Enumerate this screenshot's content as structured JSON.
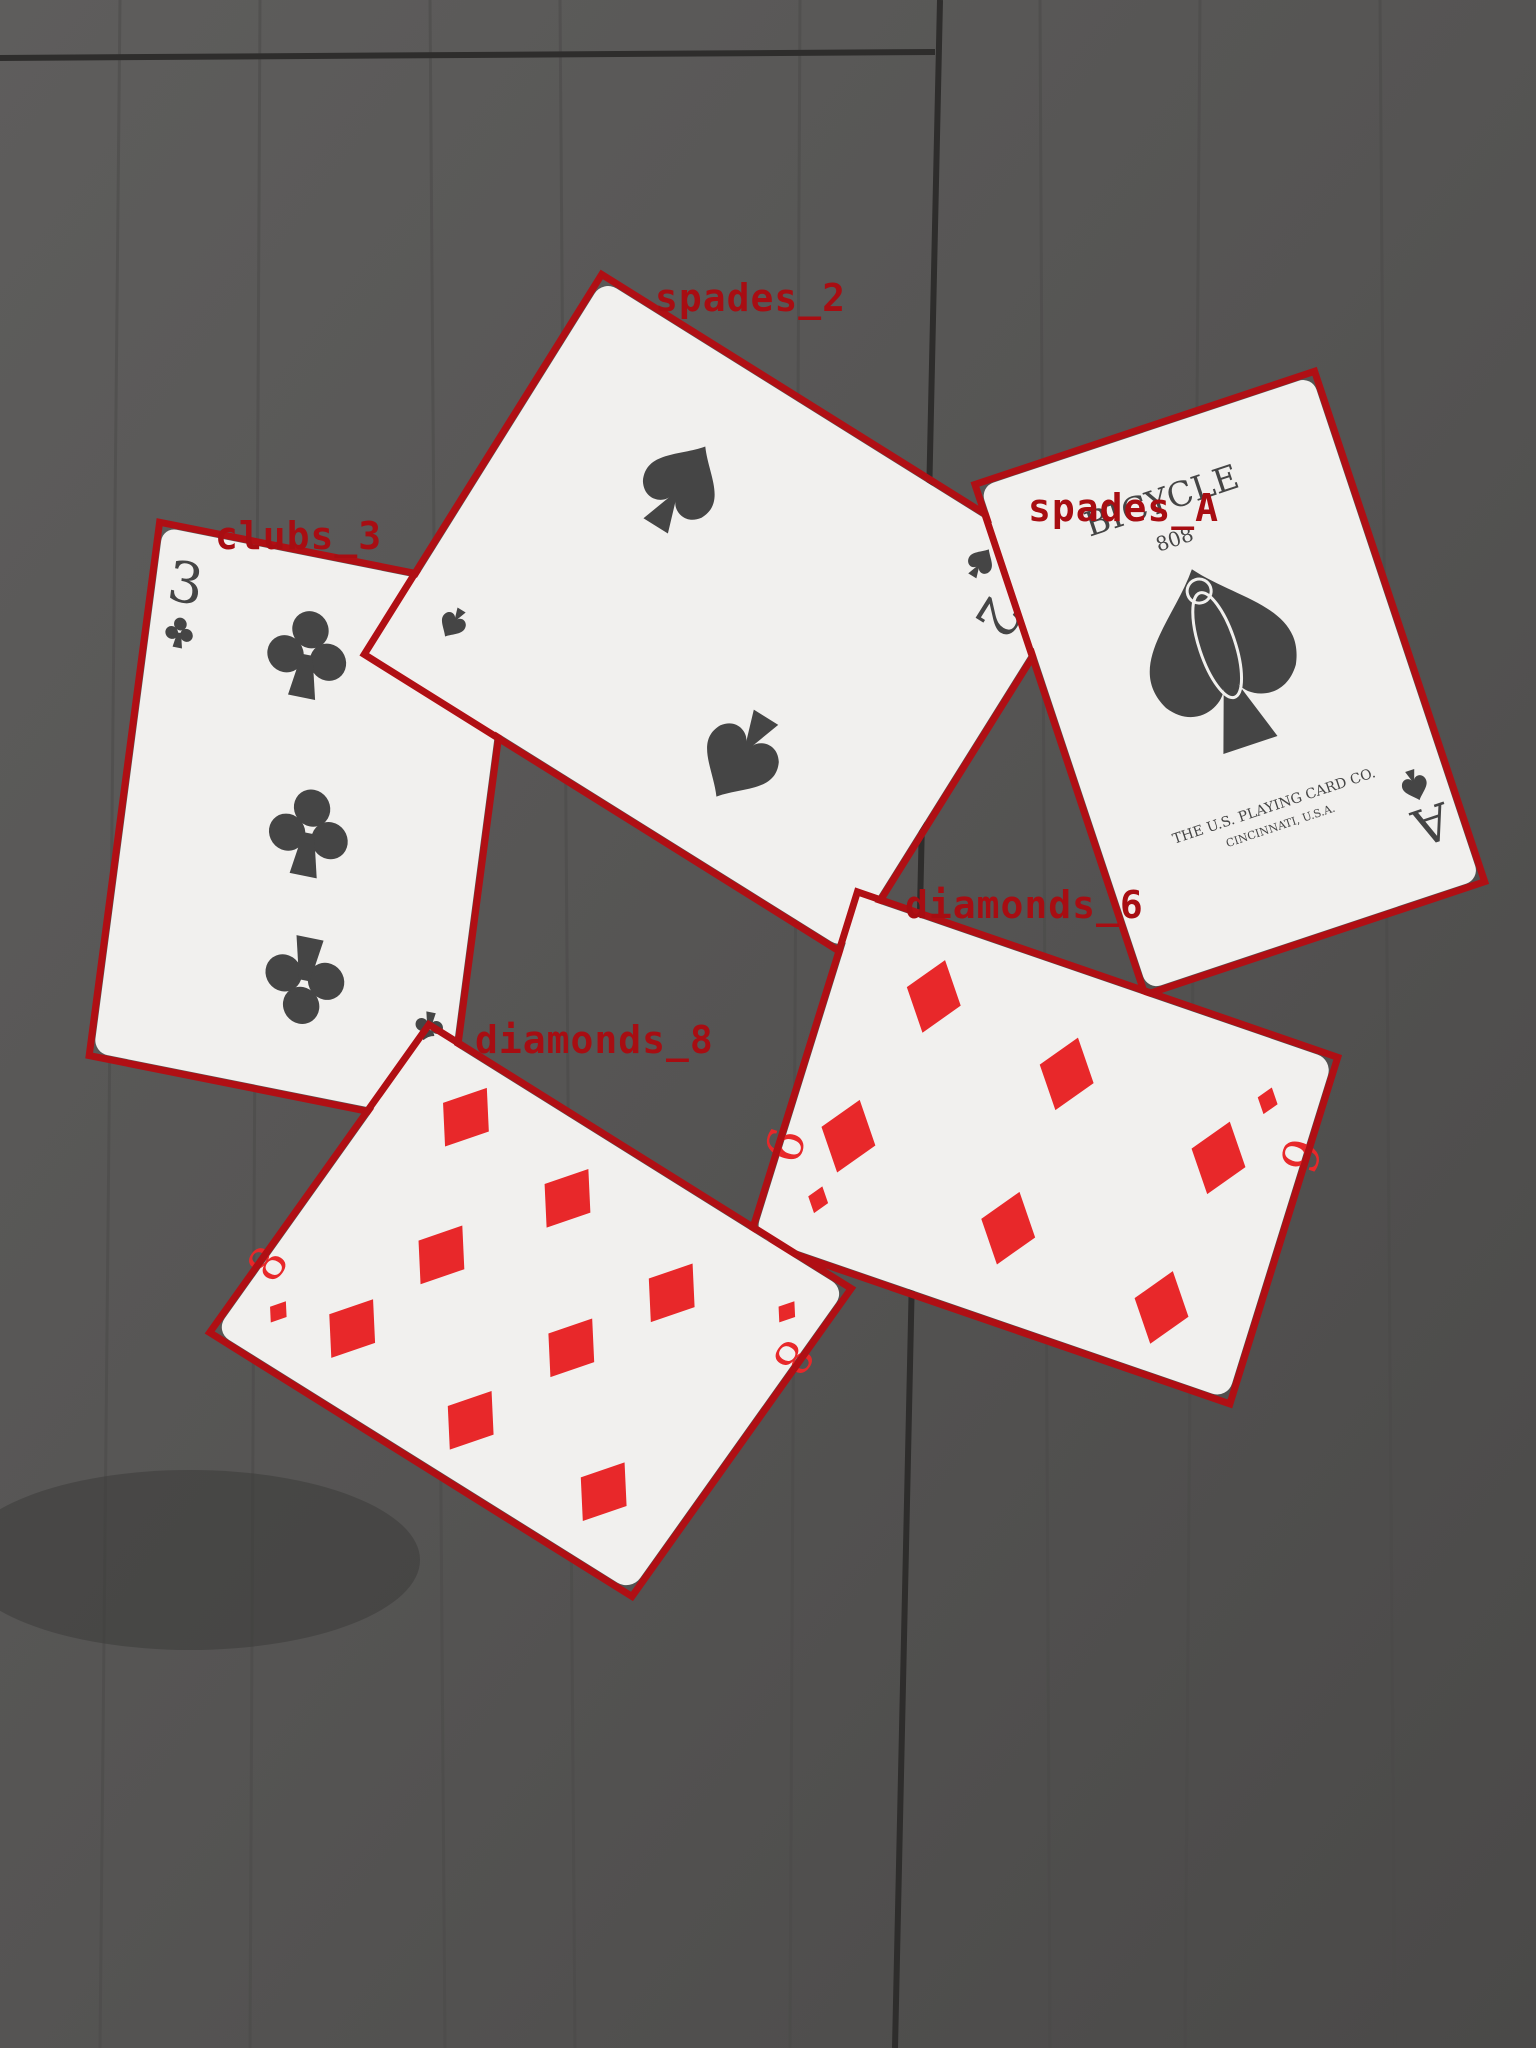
{
  "colors": {
    "floor": "#555453",
    "floor_dark": "#3f3e3d",
    "card_face": "#f1f0ee",
    "box": "#b00f14",
    "label": "#a80d12",
    "red_pip": "#e8282a",
    "black_pip": "#454545"
  },
  "detections": [
    {
      "label": "spades_2"
    },
    {
      "label": "spades_A"
    },
    {
      "label": "clubs_3"
    },
    {
      "label": "diamonds_6"
    },
    {
      "label": "diamonds_8"
    }
  ],
  "cards": {
    "clubs_3": {
      "rank": "3",
      "suit": "clubs",
      "suit_icon": "club-icon"
    },
    "spades_2": {
      "rank": "2",
      "suit": "spades",
      "suit_icon": "spade-icon"
    },
    "spades_A": {
      "rank": "A",
      "suit": "spades",
      "suit_icon": "spade-icon",
      "brand": "BICYCLE",
      "model": "808",
      "maker_line1": "THE U.S. PLAYING CARD CO.",
      "maker_line2": "CINCINNATI, U.S.A."
    },
    "diamonds_6": {
      "rank": "6",
      "suit": "diamonds",
      "suit_icon": "diamond-icon"
    },
    "diamonds_8": {
      "rank": "8",
      "suit": "diamonds",
      "suit_icon": "diamond-icon"
    }
  }
}
